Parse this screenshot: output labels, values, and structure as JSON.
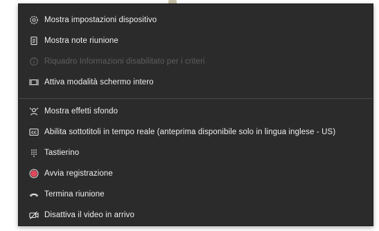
{
  "menu": {
    "items": [
      {
        "label": "Mostra impostazioni dispositivo",
        "icon": "gear-icon",
        "enabled": true
      },
      {
        "label": "Mostra note riunione",
        "icon": "notes-icon",
        "enabled": true
      },
      {
        "label": "Riquadro Informazioni disabilitato per i criteri",
        "icon": "info-icon",
        "enabled": false
      },
      {
        "label": "Attiva modalità schermo intero",
        "icon": "fullscreen-icon",
        "enabled": true
      },
      {
        "label": "Mostra effetti sfondo",
        "icon": "background-effects-icon",
        "enabled": true
      },
      {
        "label": "Abilita sottotitoli in tempo reale (anteprima disponibile solo in lingua inglese - US)",
        "icon": "captions-icon",
        "enabled": true
      },
      {
        "label": "Tastierino",
        "icon": "keypad-icon",
        "enabled": true
      },
      {
        "label": "Avvia registrazione",
        "icon": "record-icon",
        "enabled": true
      },
      {
        "label": "Termina riunione",
        "icon": "end-call-icon",
        "enabled": true
      },
      {
        "label": "Disattiva il video in arrivo",
        "icon": "video-off-icon",
        "enabled": true
      }
    ]
  },
  "colors": {
    "menu_background": "#2b2b2b",
    "text": "#f0f0f0",
    "disabled_text": "#5e5e5e",
    "record_red": "#e0495c"
  }
}
